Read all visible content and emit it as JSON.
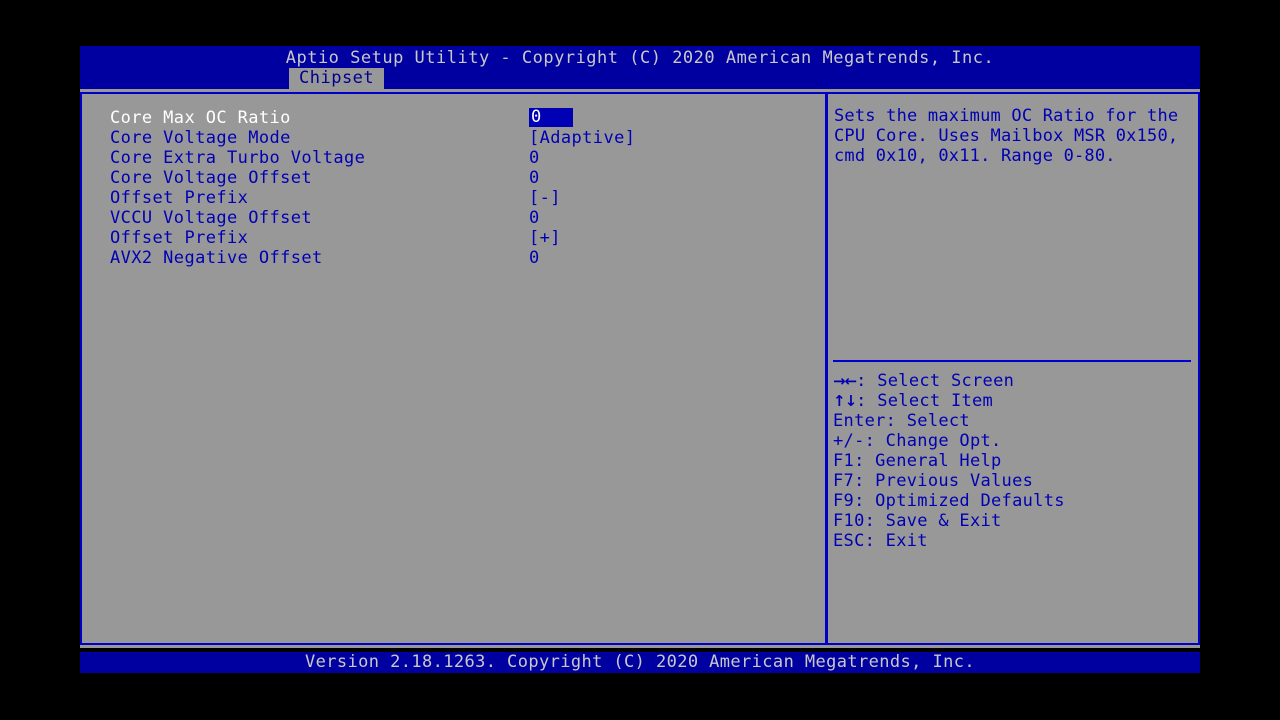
{
  "header": {
    "title": "Aptio Setup Utility - Copyright (C) 2020 American Megatrends, Inc.",
    "tabs": [
      {
        "label": "Chipset",
        "active": true
      }
    ]
  },
  "main": {
    "settings": [
      {
        "label": "Core Max OC Ratio",
        "value": "0",
        "selected": true
      },
      {
        "label": "Core Voltage Mode",
        "value": "[Adaptive]",
        "selected": false
      },
      {
        "label": "Core Extra Turbo Voltage",
        "value": "0",
        "selected": false
      },
      {
        "label": "Core Voltage Offset",
        "value": "0",
        "selected": false
      },
      {
        "label": "Offset Prefix",
        "value": "[-]",
        "selected": false
      },
      {
        "label": "VCCU Voltage Offset",
        "value": "0",
        "selected": false
      },
      {
        "label": "Offset Prefix",
        "value": "[+]",
        "selected": false
      },
      {
        "label": "AVX2 Negative Offset",
        "value": "0",
        "selected": false
      }
    ]
  },
  "help": {
    "text": "Sets the maximum OC Ratio for the CPU Core. Uses Mailbox MSR 0x150, cmd 0x10, 0x11. Range 0-80.",
    "keys": [
      {
        "glyph": "→←",
        "text": ": Select Screen"
      },
      {
        "glyph": "↑↓",
        "text": ": Select Item"
      },
      {
        "glyph": "",
        "text": "Enter: Select"
      },
      {
        "glyph": "",
        "text": "+/-: Change Opt."
      },
      {
        "glyph": "",
        "text": "F1: General Help"
      },
      {
        "glyph": "",
        "text": "F7: Previous Values"
      },
      {
        "glyph": "",
        "text": "F9: Optimized Defaults"
      },
      {
        "glyph": "",
        "text": "F10: Save & Exit"
      },
      {
        "glyph": "",
        "text": "ESC: Exit"
      }
    ]
  },
  "footer": {
    "text": "Version 2.18.1263. Copyright (C) 2020 American Megatrends, Inc."
  },
  "colors": {
    "background": "#989898",
    "title_bar": "#0000a0",
    "border": "#0000c8",
    "text_blue": "#0000b4",
    "text_light": "#c8c8c8",
    "highlight_bg": "#0000b4",
    "highlight_fg": "#ffffff"
  }
}
